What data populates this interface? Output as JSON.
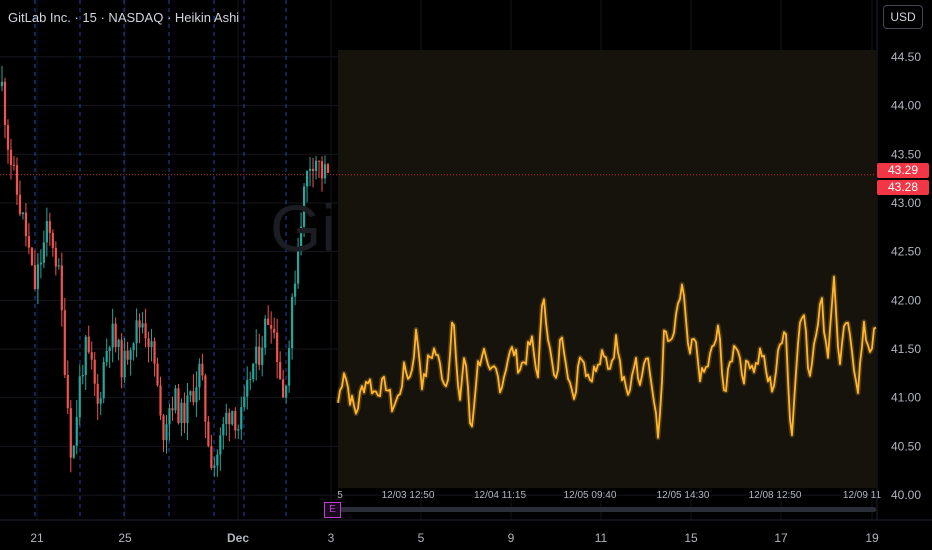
{
  "header": {
    "title": "GitLab Inc. · 15 · NASDAQ · Heikin Ashi",
    "currency_button": "USD",
    "watermark": "Gi"
  },
  "price_tags": [
    "43.29",
    "43.28"
  ],
  "event_badge": "E",
  "colors": {
    "background": "#000000",
    "up_candle": "#26a69a",
    "down_candle": "#ef5350",
    "overlay_line": "#ffb52e",
    "overlay_fill": "#16130c",
    "session_break": "#2962ff",
    "price_tag": "#f23645"
  },
  "chart_data": [
    {
      "type": "candlestick",
      "title": "GitLab Inc. · 15 · NASDAQ · Heikin Ashi",
      "x_ticks": [
        "21",
        "25",
        "Dec",
        "3",
        "5",
        "9",
        "11",
        "15",
        "17",
        "19"
      ],
      "y_ticks": [
        "40.00",
        "40.50",
        "41.00",
        "41.50",
        "42.00",
        "42.50",
        "43.00",
        "43.50",
        "44.00",
        "44.50"
      ],
      "ylim": [
        39.95,
        44.55
      ],
      "current_price": 43.29,
      "series": [
        {
          "name": "price",
          "values": [
            44.2,
            43.6,
            43.2,
            42.9,
            42.6,
            42.1,
            42.4,
            42.7,
            42.6,
            42.2,
            41.2,
            40.3,
            41.1,
            41.5,
            41.3,
            40.9,
            41.4,
            41.7,
            41.5,
            41.3,
            41.6,
            41.7,
            41.8,
            41.6,
            41.3,
            40.6,
            40.9,
            41.0,
            40.8,
            40.9,
            41.1,
            41.3,
            40.7,
            40.3,
            40.5,
            40.8,
            40.9,
            40.7,
            40.9,
            41.3,
            41.4,
            41.7,
            41.9,
            41.5,
            41.0,
            41.6,
            42.4,
            43.0,
            43.4,
            43.5,
            43.3,
            43.3
          ]
        }
      ],
      "legend_position": "none",
      "grid": true
    },
    {
      "type": "line",
      "x_ticks": [
        "5",
        "12/03 12:50",
        "12/04 11:15",
        "12/05 09:40",
        "12/05 14:30",
        "12/08 12:50",
        "12/09 11"
      ],
      "ylim": [
        39.95,
        44.55
      ],
      "series": [
        {
          "name": "",
          "values": [
            40.95,
            41.3,
            41.0,
            40.85,
            41.1,
            41.2,
            41.05,
            41.1,
            41.15,
            40.9,
            41.0,
            41.3,
            41.2,
            41.7,
            41.1,
            41.4,
            41.5,
            41.3,
            41.1,
            41.9,
            40.9,
            41.5,
            40.6,
            41.3,
            41.5,
            41.2,
            41.3,
            41.1,
            41.4,
            41.5,
            41.3,
            41.4,
            41.6,
            41.2,
            42.1,
            41.5,
            41.1,
            41.7,
            41.3,
            40.9,
            41.5,
            41.3,
            41.2,
            41.4,
            41.5,
            41.3,
            41.6,
            41.2,
            41.0,
            41.4,
            41.2,
            41.5,
            41.1,
            40.55,
            41.7,
            41.5,
            41.8,
            42.2,
            41.4,
            41.6,
            41.2,
            41.3,
            41.5,
            41.7,
            41.0,
            41.4,
            41.6,
            41.2,
            41.4,
            41.3,
            41.5,
            41.2,
            41.1,
            41.5,
            41.8,
            40.5,
            41.6,
            41.9,
            41.2,
            41.7,
            42.0,
            41.4,
            42.25,
            41.3,
            41.8,
            41.5,
            41.1,
            41.7,
            41.5,
            41.7
          ]
        }
      ],
      "legend_position": "none",
      "grid": false
    }
  ]
}
